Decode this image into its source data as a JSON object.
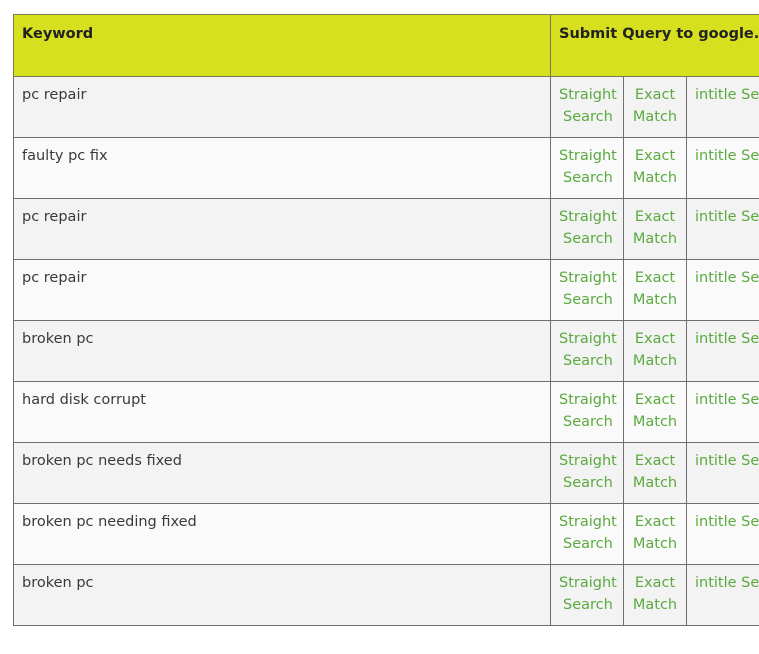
{
  "header": {
    "keyword": "Keyword",
    "submit": "Submit Query to google.com"
  },
  "rows": [
    {
      "keyword": "pc repair",
      "straight": "Straight Search",
      "exact": "Exact Match",
      "intitle": "intitle Search"
    },
    {
      "keyword": "faulty pc fix",
      "straight": "Straight Search",
      "exact": "Exact Match",
      "intitle": "intitle Search"
    },
    {
      "keyword": "pc repair",
      "straight": "Straight Search",
      "exact": "Exact Match",
      "intitle": "intitle Search"
    },
    {
      "keyword": "pc repair",
      "straight": "Straight Search",
      "exact": "Exact Match",
      "intitle": "intitle Search"
    },
    {
      "keyword": "broken pc",
      "straight": "Straight Search",
      "exact": "Exact Match",
      "intitle": "intitle Search"
    },
    {
      "keyword": "hard disk corrupt",
      "straight": "Straight Search",
      "exact": "Exact Match",
      "intitle": "intitle Search"
    },
    {
      "keyword": "broken pc needs fixed",
      "straight": "Straight Search",
      "exact": "Exact Match",
      "intitle": "intitle Search"
    },
    {
      "keyword": "broken pc needing fixed",
      "straight": "Straight Search",
      "exact": "Exact Match",
      "intitle": "intitle Search"
    },
    {
      "keyword": "broken pc",
      "straight": "Straight Search",
      "exact": "Exact Match",
      "intitle": "intitle Search"
    }
  ],
  "colors": {
    "header_bg": "#d6e01f",
    "link": "#5aaa3f",
    "text": "#3a3a3a"
  }
}
